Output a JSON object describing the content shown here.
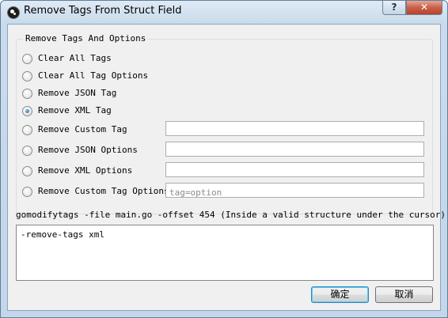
{
  "window": {
    "title": "Remove Tags From Struct Field",
    "help_label": "?",
    "close_label": "✕"
  },
  "group": {
    "legend": "Remove Tags And Options"
  },
  "options": [
    {
      "label": "Clear All Tags",
      "checked": false
    },
    {
      "label": "Clear All Tag Options",
      "checked": false
    },
    {
      "label": "Remove JSON Tag",
      "checked": false
    },
    {
      "label": "Remove XML Tag",
      "checked": true
    },
    {
      "label": "Remove Custom Tag",
      "checked": false,
      "input_value": "",
      "input_placeholder": ""
    },
    {
      "label": "Remove JSON Options",
      "checked": false,
      "input_value": "",
      "input_placeholder": ""
    },
    {
      "label": "Remove XML Options",
      "checked": false,
      "input_value": "",
      "input_placeholder": ""
    },
    {
      "label": "Remove Custom Tag Options",
      "checked": false,
      "input_value": "",
      "input_placeholder": "tag=option"
    }
  ],
  "command": {
    "line": "gomodifytags -file main.go -offset 454 (Inside a valid structure under the cursor)",
    "output": "-remove-tags xml"
  },
  "buttons": {
    "ok": "确定",
    "cancel": "取消"
  }
}
